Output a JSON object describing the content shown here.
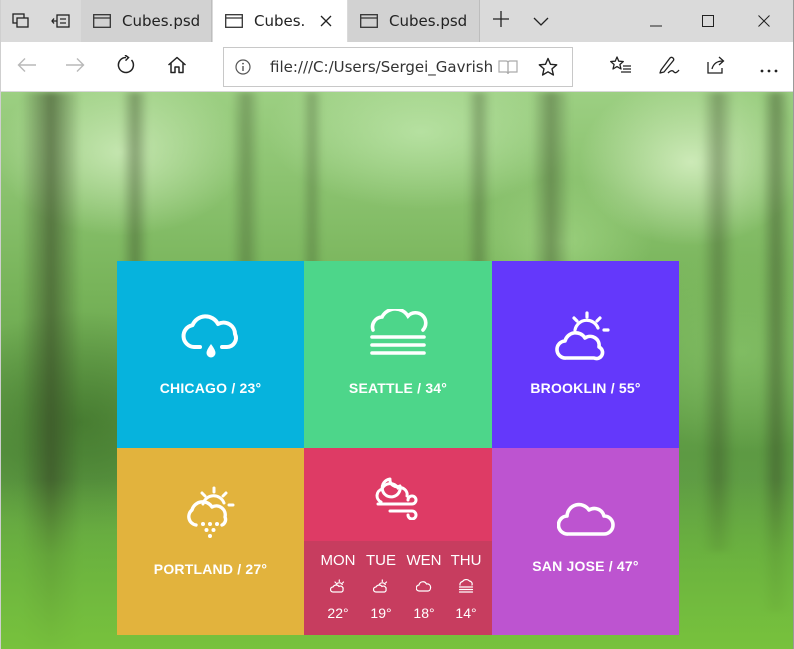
{
  "browser": {
    "tabs": [
      {
        "label": "Cubes.psd",
        "active": false
      },
      {
        "label": "Cubes.psd",
        "active": true
      },
      {
        "label": "Cubes.psd",
        "active": false
      }
    ],
    "address": "file:///C:/Users/Sergei_Gavrish/"
  },
  "colors": {
    "chicago": "#06b3dd",
    "seattle": "#4dd68a",
    "brooklin": "#6438fb",
    "portland": "#e2b33d",
    "forecast_top": "#de3b65",
    "forecast_bottom": "#c73d5f",
    "san_jose": "#bd54d0"
  },
  "tiles": {
    "chicago": {
      "label": "CHICAGO / 23°",
      "icon": "cloud-rain-drop-icon"
    },
    "seattle": {
      "label": "SEATTLE / 34°",
      "icon": "cloud-fog-icon"
    },
    "brooklin": {
      "label": "BROOKLIN / 55°",
      "icon": "sun-cloud-icon"
    },
    "portland": {
      "label": "PORTLAND / 27°",
      "icon": "sun-cloud-snow-icon"
    },
    "san_jose": {
      "label": "SAN JOSE / 47°",
      "icon": "cloud-icon"
    },
    "forecast": {
      "icon": "moon-cloud-wind-icon",
      "days": [
        {
          "day": "MON",
          "temp": "22°",
          "icon": "sun-cloud-icon"
        },
        {
          "day": "TUE",
          "temp": "19°",
          "icon": "sun-cloud-icon"
        },
        {
          "day": "WEN",
          "temp": "18°",
          "icon": "cloud-icon"
        },
        {
          "day": "THU",
          "temp": "14°",
          "icon": "cloud-fog-icon"
        }
      ]
    }
  }
}
